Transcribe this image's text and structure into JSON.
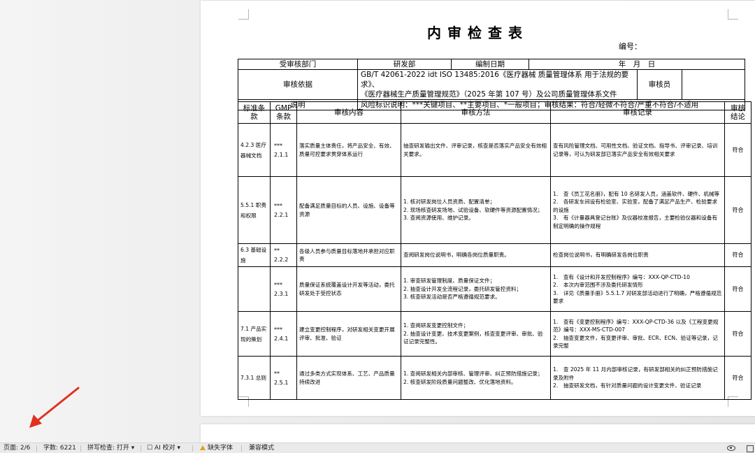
{
  "document": {
    "title": "内审检查表",
    "number_label": "编号："
  },
  "header": {
    "dept_label": "受审核部门",
    "dept_value": "研发部",
    "date_label": "编制日期",
    "date_value": "年　月　日",
    "basis_label": "审核依据",
    "basis_line1": "GB/T 42061-2022 idt ISO 13485:2016《医疗器械 质量管理体系 用于法规的要求》、",
    "basis_line2": "《医疗器械生产质量管理规范》（2025 年第 107 号）及公司质量管理体系文件",
    "auditor_label": "审核员",
    "auditor_value": "",
    "note_label": "说明",
    "note_value": "风险标识说明：***关键项目、**主要项目、*一般项目；审核结果：符合/轻微不符合/严重不符合/不适用"
  },
  "table": {
    "columns": [
      "标准条款",
      "GMP条款",
      "审核内容",
      "审核方法",
      "审核记录",
      "审核结论"
    ],
    "col_std_l1": "标准条",
    "col_std_l2": "款",
    "col_gmp_l1": "GMP",
    "col_gmp_l2": "条款",
    "col_con_l1": "审核",
    "col_con_l2": "结论",
    "rows": [
      {
        "std": "4.2.3 医疗器械文档",
        "gmp_level": "***",
        "gmp_no": "2.1.1",
        "content": "落实质量主体责任，将产品安全、有效、质量可控要求贯穿体系运行",
        "method": [
          "抽查研发输出文件、评审记录，核查是否落实产品安全有效相关要求。"
        ],
        "record": [
          "查有风险管理文档、可用性文档、验证文档、指导书、评审记录、培训记录等，可认为研发部已落实产品安全有效相关要求"
        ],
        "conclusion": "符合"
      },
      {
        "std": "5.5.1 职责和权限",
        "gmp_level": "***",
        "gmp_no": "2.2.1",
        "content": "配备满足质量目标的人员、设施、设备等资源",
        "method": [
          "1. 核对研发岗位人员资质、配置清单；",
          "2. 现场核查研发场地、试验设备、软硬件等资源配置情况；",
          "3. 查阅资源使用、维护记录。"
        ],
        "record": [
          "1.　查《员工花名册》，配有 10 名研发人员，涵盖软件、硬件、机械等",
          "2.　各研发车间设有检验室、实验室，配备了满足产品生产、检验要求的设施",
          "3.　有《计量器具登记台账》及仪器校准报告，主要检验仪器和设备有制定明确的操作规程"
        ],
        "conclusion": "符合"
      },
      {
        "std": "6.3 基础设施",
        "gmp_level": "**",
        "gmp_no": "2.2.2",
        "content": "各级人员参与质量目标落地并承担对应职责",
        "method": [
          "查阅研发岗位说明书，明确各岗位质量职责。"
        ],
        "record": [
          "检查岗位说明书，有明确研发各岗位职责"
        ],
        "conclusion": "符合"
      },
      {
        "std": "",
        "gmp_level": "***",
        "gmp_no": "2.3.1",
        "content": "质量保证系统覆盖设计开发等活动，委托研发处于受控状态",
        "method": [
          "1. 审查研发管理制度、质量保证文件；",
          "2. 抽查设计开发全流程记录，委托研发管控资料；",
          "3. 核查研发活动是否严格遵循规范要求。"
        ],
        "record": [
          "1.　查有《设计和开发控制程序》编号：XXX-QP-CTD-10",
          "2.　本次内审范围不涉及委托研发情形",
          "3.　详见《质量手册》5.5.1.7 对研发部活动进行了明确，严格遵循规范要求"
        ],
        "conclusion": "符合"
      },
      {
        "std": "7.1 产品实现的策划",
        "gmp_level": "***",
        "gmp_no": "2.4.1",
        "content": "建立变更控制程序，对研发相关变更开展评审、批准、验证",
        "method": [
          "1. 查阅研发变更控制文件；",
          "2. 抽查设计变更、技术变更案例，核查变更评审、审批、验证记录完整性。"
        ],
        "record": [
          "1.　查有《变更控制程序》编号：XXX-QP-CTD-36 以及《工程变更规范》编号：XXX-MS-CTD-007",
          "2.　抽查变更文件，有变更评审、审批、ECR、ECN、验证等记录，记录完整"
        ],
        "conclusion": "符合"
      },
      {
        "std": "7.3.1 总则",
        "gmp_level": "**",
        "gmp_no": "2.5.1",
        "content": "通过多类方式实现体系、工艺、产品质量持续改进",
        "method": [
          "1. 查阅研发相关内部审核、管理评审、纠正预防措施记录；",
          "2. 核查研发阶段质量问题整改、优化落地资料。"
        ],
        "record": [
          "1.　查 2025 年 11 月内部审核记录，有研发部相关的纠正预防措施记录及附件",
          "2.　抽查研发文档，有针对质量问题的设计变更文件、验证记录"
        ],
        "conclusion": "符合"
      }
    ]
  },
  "status_bar": {
    "page": "页面: 2/6",
    "words": "字数: 6221",
    "spell": "拼写检查: 打开 ▾",
    "ai": "AI 校对 ▾",
    "fonts": "缺失字体",
    "compat": "兼容模式"
  },
  "colors": {
    "arrow": "#e03020",
    "warning": "#e0a21a"
  }
}
